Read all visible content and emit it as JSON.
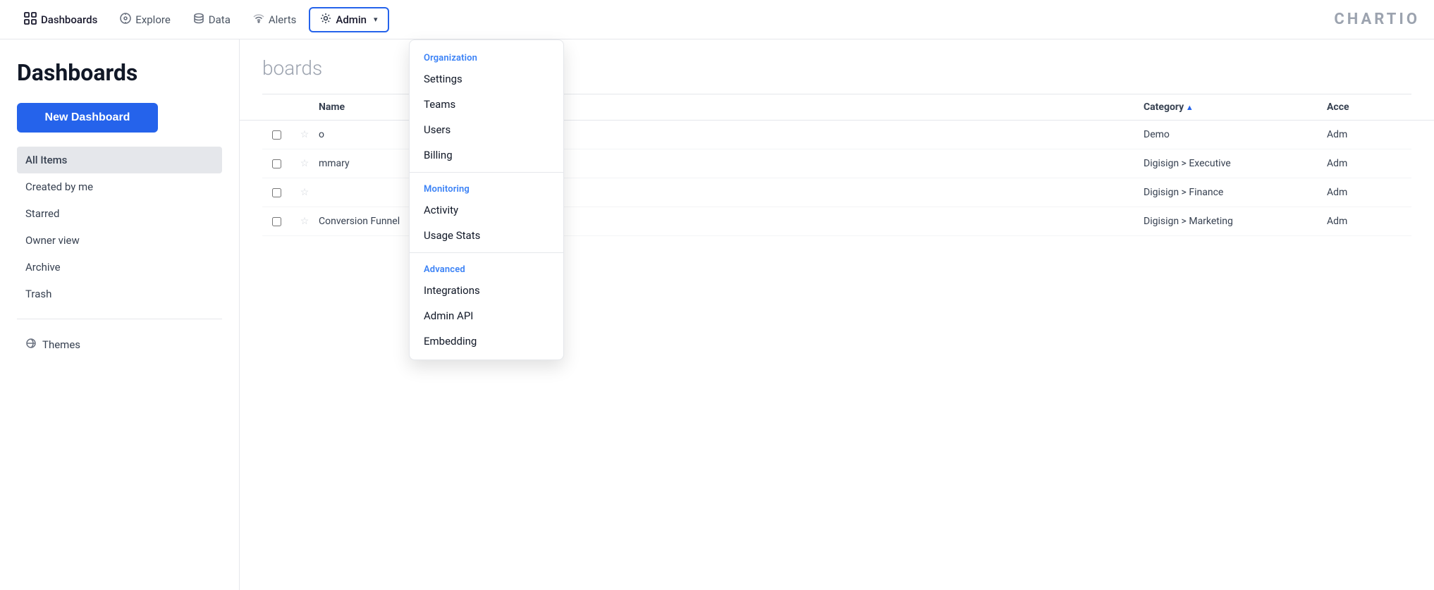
{
  "app": {
    "brand": "CHARTIO"
  },
  "topnav": {
    "items": [
      {
        "id": "dashboards",
        "label": "Dashboards",
        "icon": "grid",
        "active": true
      },
      {
        "id": "explore",
        "label": "Explore",
        "icon": "compass"
      },
      {
        "id": "data",
        "label": "Data",
        "icon": "database"
      },
      {
        "id": "alerts",
        "label": "Alerts",
        "icon": "wifi"
      },
      {
        "id": "admin",
        "label": "Admin",
        "icon": "gear",
        "active_dropdown": true,
        "has_chevron": true
      }
    ]
  },
  "sidebar": {
    "title": "Dashboards",
    "new_dashboard_label": "New Dashboard",
    "nav_items": [
      {
        "id": "all-items",
        "label": "All Items",
        "active": true
      },
      {
        "id": "created-by-me",
        "label": "Created by me"
      },
      {
        "id": "starred",
        "label": "Starred"
      },
      {
        "id": "owner-view",
        "label": "Owner view"
      },
      {
        "id": "archive",
        "label": "Archive"
      },
      {
        "id": "trash",
        "label": "Trash"
      }
    ],
    "themes_label": "Themes"
  },
  "content": {
    "title": "boards",
    "table": {
      "columns": [
        {
          "id": "name",
          "label": "Name"
        },
        {
          "id": "category",
          "label": "Category",
          "sorted": "asc"
        },
        {
          "id": "access",
          "label": "Acce"
        }
      ],
      "rows": [
        {
          "name": "o",
          "category": "Demo",
          "access": "Adm"
        },
        {
          "name": "mmary",
          "category": "Digisign > Executive",
          "access": "Adm"
        },
        {
          "name": "",
          "category": "Digisign > Finance",
          "access": "Adm"
        },
        {
          "name": "Conversion Funnel",
          "category": "Digisign > Marketing",
          "access": "Adm"
        }
      ]
    }
  },
  "dropdown": {
    "sections": [
      {
        "id": "organization",
        "label": "Organization",
        "items": [
          {
            "id": "settings",
            "label": "Settings"
          },
          {
            "id": "teams",
            "label": "Teams"
          },
          {
            "id": "users",
            "label": "Users"
          },
          {
            "id": "billing",
            "label": "Billing"
          }
        ]
      },
      {
        "id": "monitoring",
        "label": "Monitoring",
        "items": [
          {
            "id": "activity",
            "label": "Activity"
          },
          {
            "id": "usage-stats",
            "label": "Usage Stats"
          }
        ]
      },
      {
        "id": "advanced",
        "label": "Advanced",
        "items": [
          {
            "id": "integrations",
            "label": "Integrations"
          },
          {
            "id": "admin-api",
            "label": "Admin API"
          },
          {
            "id": "embedding",
            "label": "Embedding"
          }
        ]
      }
    ]
  }
}
